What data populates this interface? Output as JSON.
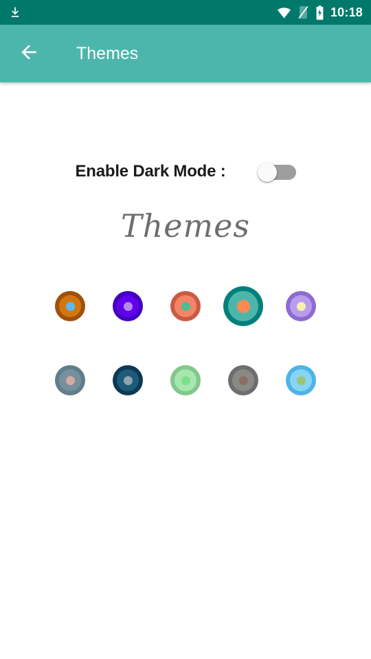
{
  "status_bar": {
    "background": "#00796B",
    "time": "10:18",
    "left_icons": [
      {
        "name": "download-icon"
      }
    ],
    "right_icons": [
      {
        "name": "wifi-icon"
      },
      {
        "name": "no-sim-icon"
      },
      {
        "name": "battery-charging-icon"
      }
    ]
  },
  "toolbar": {
    "background": "#4DB6AC",
    "back_icon": "arrow-back-icon",
    "title": "Themes"
  },
  "settings": {
    "dark_mode_label": "Enable Dark Mode :",
    "dark_mode_enabled": false,
    "switch_track_color": "#9E9E9E",
    "switch_thumb_color": "#FAFAFA"
  },
  "themes_section": {
    "heading": "Themes",
    "heading_color": "#6e6e6e",
    "selected_index": 3,
    "swatches": [
      {
        "name": "theme-swatch-orange-brown",
        "outer": "#A0500B",
        "mid": "#D2770F",
        "dot": "#5BB8F5",
        "selected": false
      },
      {
        "name": "theme-swatch-violet",
        "outer": "#4300C0",
        "mid": "#6200EE",
        "dot": "#B388E8",
        "selected": false
      },
      {
        "name": "theme-swatch-salmon",
        "outer": "#C95B44",
        "mid": "#F48468",
        "dot": "#4DBD92",
        "selected": false
      },
      {
        "name": "theme-swatch-teal",
        "outer": "#00807A",
        "mid": "#4DB6AC",
        "dot": "#FF8A50",
        "selected": true
      },
      {
        "name": "theme-swatch-lavender",
        "outer": "#8E6BD0",
        "mid": "#B89CF0",
        "dot": "#F7F2A8",
        "selected": false
      },
      {
        "name": "theme-swatch-blue-grey",
        "outer": "#607D8B",
        "mid": "#78909C",
        "dot": "#D7A9A0",
        "selected": false
      },
      {
        "name": "theme-swatch-dark-navy",
        "outer": "#0D3A52",
        "mid": "#1E5A7A",
        "dot": "#90A4AE",
        "selected": false
      },
      {
        "name": "theme-swatch-light-green",
        "outer": "#80C98A",
        "mid": "#A8E6B0",
        "dot": "#7BE08A",
        "selected": false
      },
      {
        "name": "theme-swatch-grey",
        "outer": "#6E6E6E",
        "mid": "#8A8A85",
        "dot": "#8A6E63",
        "selected": false
      },
      {
        "name": "theme-swatch-sky-blue",
        "outer": "#4FB3E8",
        "mid": "#87D5F5",
        "dot": "#9CC47A",
        "selected": false
      }
    ]
  }
}
